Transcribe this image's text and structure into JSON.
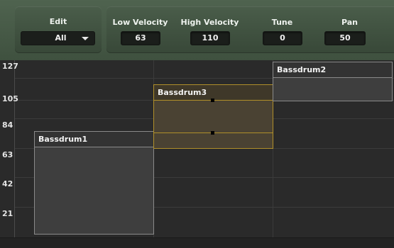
{
  "header": {
    "edit": {
      "label": "Edit",
      "selected": "All"
    },
    "low_velocity": {
      "label": "Low Velocity",
      "value": "63"
    },
    "high_velocity": {
      "label": "High Velocity",
      "value": "110"
    },
    "tune": {
      "label": "Tune",
      "value": "0"
    },
    "pan": {
      "label": "Pan",
      "value": "50"
    }
  },
  "axis": {
    "labels": [
      "127",
      "105",
      "84",
      "63",
      "42",
      "21"
    ]
  },
  "regions": [
    {
      "name": "Bassdrum1",
      "selected": false
    },
    {
      "name": "Bassdrum3",
      "selected": true
    },
    {
      "name": "Bassdrum2",
      "selected": false
    }
  ],
  "colors": {
    "panel_green": "#4a5d4a",
    "grid_bg": "#2a2a2a",
    "selection_gold": "#b08f2a"
  }
}
